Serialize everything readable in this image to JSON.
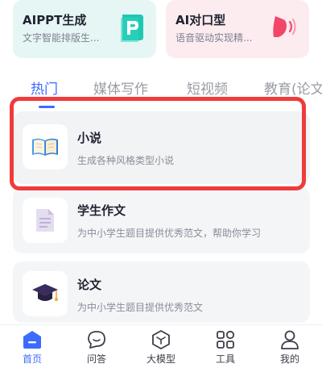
{
  "top_cards": [
    {
      "title": "AIPPT生成",
      "subtitle": "文字智能排版生...",
      "icon": "ppt-icon",
      "color": "#1fc8b2"
    },
    {
      "title": "AI对口型",
      "subtitle": "语音驱动实现精...",
      "icon": "lip-sync-icon",
      "color": "#f2476b"
    }
  ],
  "tabs": [
    {
      "label": "热门",
      "active": true
    },
    {
      "label": "媒体写作",
      "active": false
    },
    {
      "label": "短视频",
      "active": false
    },
    {
      "label": "教育(论文",
      "active": false
    }
  ],
  "cards": [
    {
      "title": "小说",
      "desc": "生成各种风格类型小说",
      "icon": "open-book-icon"
    },
    {
      "title": "学生作文",
      "desc": "为中小学生题目提供优秀范文，帮助你学习",
      "icon": "document-icon"
    },
    {
      "title": "论文",
      "desc": "为中小学生题目提供优秀范文",
      "icon": "graduation-cap-icon"
    }
  ],
  "bottom_nav": [
    {
      "label": "首页",
      "icon": "home-icon",
      "active": true
    },
    {
      "label": "问答",
      "icon": "chat-bubble-icon",
      "active": false
    },
    {
      "label": "大模型",
      "icon": "cube-icon",
      "active": false
    },
    {
      "label": "工具",
      "icon": "grid-icon",
      "active": false
    },
    {
      "label": "我的",
      "icon": "user-icon",
      "active": false
    }
  ],
  "colors": {
    "accent": "#3d6bff",
    "highlight": "#ef3b3b"
  }
}
